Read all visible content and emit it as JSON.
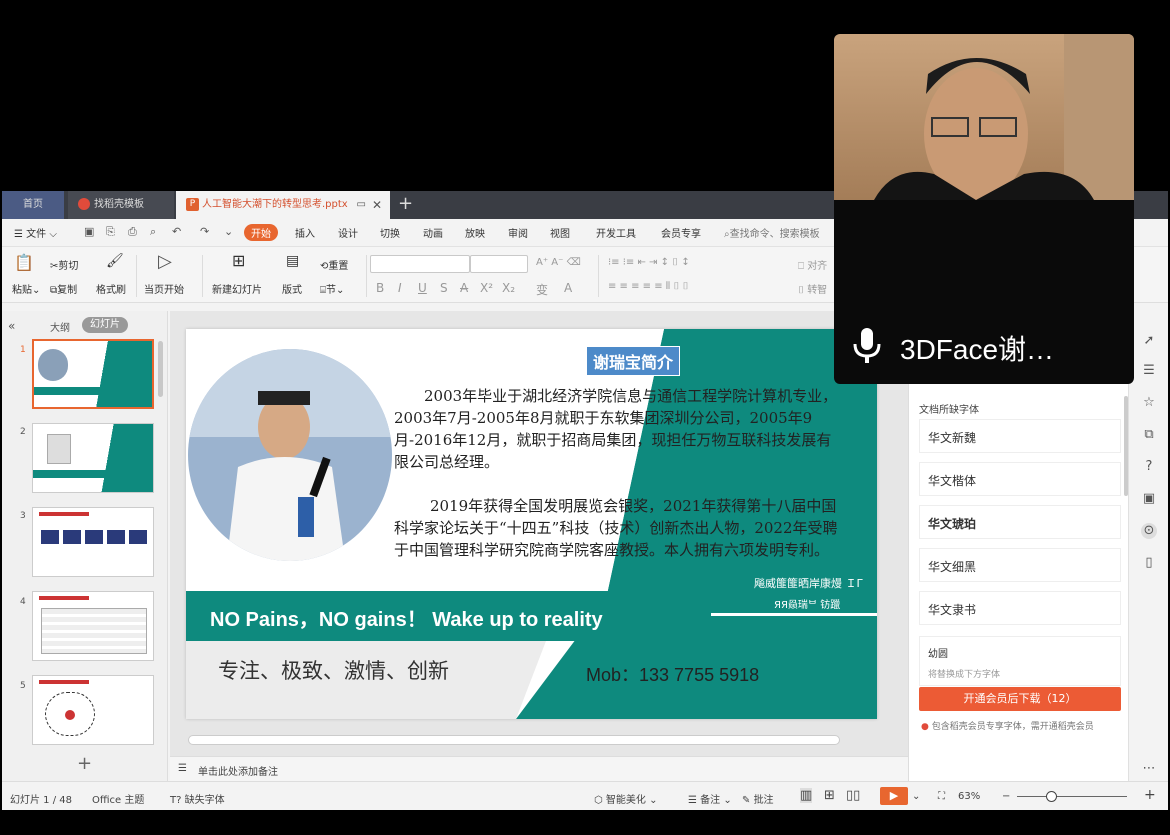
{
  "tabs": {
    "home": "首页",
    "template": "找稻壳模板",
    "document": "人工智能大潮下的转型思考.pptx",
    "doc_icon": "P",
    "add": "+"
  },
  "menu": {
    "file": "文件",
    "items": [
      "开始",
      "插入",
      "设计",
      "切换",
      "动画",
      "放映",
      "审阅",
      "视图",
      "开发工具",
      "会员专享"
    ],
    "search_placeholder": "查找命令、搜索模板"
  },
  "ribbon": {
    "paste": "粘贴",
    "cut": "剪切",
    "copy": "复制",
    "format_painter": "格式刷",
    "slideshow_start": "当页开始",
    "new_slide": "新建幻灯片",
    "layout": "版式",
    "section": "节",
    "reset": "重置",
    "align": "对齐",
    "convert": "转智"
  },
  "left_panel": {
    "outline_tab": "大纲",
    "slides_tab": "幻灯片",
    "thumb_numbers": [
      "1",
      "2",
      "3",
      "4",
      "5"
    ],
    "add": "+"
  },
  "slide": {
    "title": "谢瑞宝简介",
    "para1": "2003年毕业于湖北经济学院信息与通信工程学院计算机专业，2003年7月-2005年8月就职于东软集团深圳分公司，2005年9月-2016年12月，就职于招商局集团，现担任万物互联科技发展有限公司总经理。",
    "para2": "2019年获得全国发明展览会银奖，2021年获得第十八届中国科学家论坛关于“十四五”科技（技术）创新杰出人物，2022年受聘于中国管理科学研究院商学院客座教授。本人拥有六项发明专利。",
    "banner": "NO  Pains，NO  gains！  Wake up to reality",
    "garbled1": "飚威篚篚晒岸康熳 ＩΓ",
    "garbled2": "ЯЯ赑瑞ᄇ 钫躐",
    "motto": "专注、极致、激情、创新",
    "mobile": "Mob：133 7755 5918"
  },
  "notes_placeholder": "单击此处添加备注",
  "right_panel": {
    "section_title": "文档所缺字体",
    "fonts": [
      "华文新魏",
      "华文楷体",
      "华文琥珀",
      "华文细黑",
      "华文隶书"
    ],
    "missing_font": "幼圆",
    "missing_hint": "将替换成下方字体",
    "download_button": "开通会员后下载（12）",
    "note": "包含稻壳会员专享字体，需开通稻壳会员"
  },
  "status": {
    "slide_count": "幻灯片 1 / 48",
    "theme": "Office 主题",
    "missing_font": "缺失字体",
    "beautify": "智能美化",
    "notes": "备注",
    "comments": "批注",
    "zoom": "63%"
  },
  "camera": {
    "name": "3DFace谢…"
  },
  "colors": {
    "accent": "#e8662f",
    "teal": "#0e8a7e",
    "title_box": "#4d8ac9",
    "download": "#ec5b35"
  }
}
